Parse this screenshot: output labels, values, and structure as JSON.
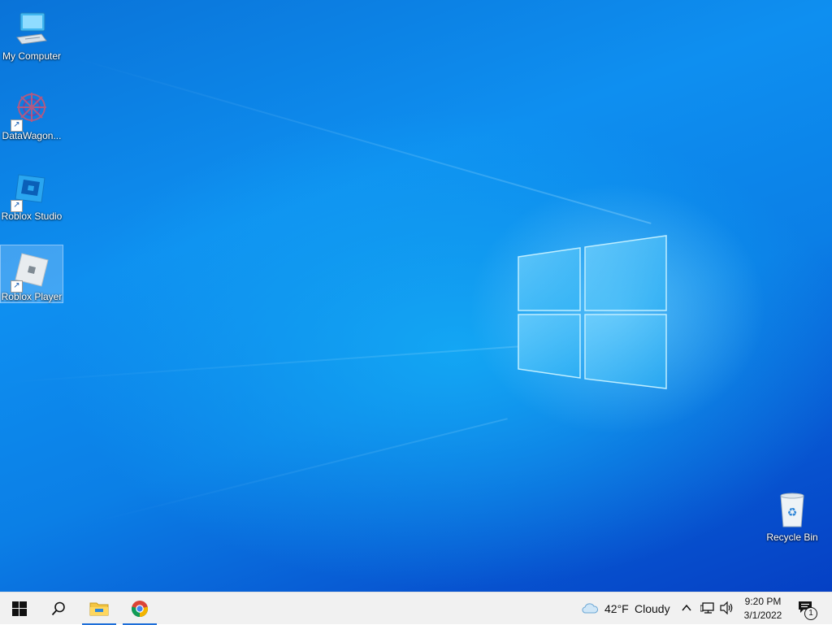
{
  "desktop": {
    "icons": [
      {
        "label": "My Computer",
        "icon": "computer-icon",
        "shortcut": false,
        "selected": false
      },
      {
        "label": "DataWagon...",
        "icon": "datawagon-icon",
        "shortcut": true,
        "selected": false
      },
      {
        "label": "Roblox Studio",
        "icon": "roblox-studio-icon",
        "shortcut": true,
        "selected": false
      },
      {
        "label": "Roblox Player",
        "icon": "roblox-player-icon",
        "shortcut": true,
        "selected": true
      },
      {
        "label": "Recycle Bin",
        "icon": "recycle-bin-icon",
        "shortcut": false,
        "selected": false
      }
    ]
  },
  "taskbar": {
    "start": "windows-start-icon",
    "search": "search-icon",
    "pinned": [
      {
        "icon": "file-explorer-icon",
        "active": true
      },
      {
        "icon": "chrome-icon",
        "active": true
      }
    ],
    "weather": {
      "icon": "cloud-icon",
      "temperature": "42°F",
      "condition": "Cloudy"
    },
    "tray": [
      "chevron-up-icon",
      "network-icon",
      "volume-icon"
    ],
    "clock": {
      "time": "9:20 PM",
      "date": "3/1/2022"
    },
    "notifications": {
      "icon": "action-center-icon",
      "count": "1"
    }
  },
  "colors": {
    "accent": "#1e6fd9",
    "taskbar": "#f1f1f1",
    "wallpaper": "#0b7fe6"
  }
}
